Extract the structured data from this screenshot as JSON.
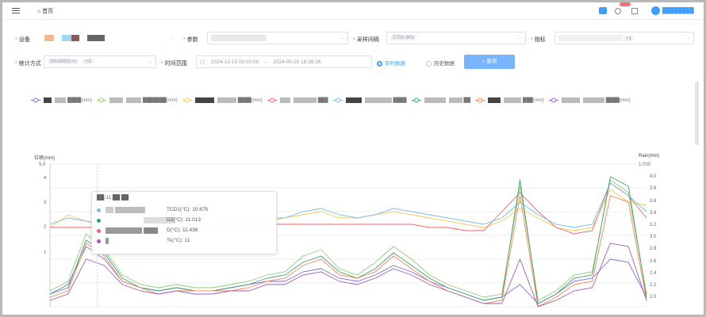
{
  "header": {
    "home_label": "首页",
    "user_name": "████████"
  },
  "filters": {
    "row1": [
      {
        "label": "设备",
        "value": ""
      },
      {
        "label": "参数",
        "value": "██"
      },
      {
        "label": "采样间隔",
        "value": "2700-90s"
      },
      {
        "label": "指标",
        "value": "+1"
      }
    ],
    "row2": {
      "label_a": "统计方式",
      "select_value": "30s/900s+x",
      "select_tag": "+3",
      "time_label": "时间范围",
      "start": "2024-12-15 00:00:00",
      "end": "2024-05-20 18:38:26",
      "radio_on": "实时数据",
      "radio_off": "历史数据",
      "query_button": "查询"
    }
  },
  "legend": [
    {
      "name": "████(mm)",
      "color": "#7b6fd8"
    },
    {
      "name": "███████(mm)",
      "color": "#91cc75"
    },
    {
      "name": "████(mm)",
      "color": "#fac858"
    },
    {
      "name": "███",
      "color": "#ee6666"
    },
    {
      "name": "████",
      "color": "#73c0de"
    },
    {
      "name": "██",
      "color": "#3ba272"
    },
    {
      "name": "███(mm)",
      "color": "#fc8452"
    },
    {
      "name": "████(mm)",
      "color": "#9a60b4"
    }
  ],
  "chart_data": {
    "type": "line",
    "ylabel_left": "位移(mm)",
    "ylabel_right": "Rain(mm)",
    "y_left_ticks": [
      "5.0",
      "4",
      "3",
      "2",
      "1"
    ],
    "y_right_ticks": [
      "1.000",
      "4.0",
      "3.8",
      "3.6",
      "3.4",
      "3.2",
      "3.0",
      "2.8",
      "2.6",
      "2.4",
      "2.2",
      "2.0"
    ],
    "series": [
      {
        "color": "#7b6fd8",
        "values": [
          0.9,
          1.2,
          2.4,
          2.0,
          1.3,
          1.1,
          1.0,
          1.1,
          1.0,
          1.0,
          1.1,
          1.2,
          1.3,
          1.3,
          1.6,
          1.7,
          1.4,
          1.3,
          1.5,
          1.8,
          1.6,
          1.3,
          1.1,
          0.9,
          0.7,
          0.8,
          1.2,
          0.6,
          0.9,
          1.3,
          1.4,
          2.0,
          1.9,
          0.8
        ]
      },
      {
        "color": "#91cc75",
        "values": [
          1.0,
          1.3,
          2.8,
          2.3,
          1.5,
          1.2,
          1.1,
          1.2,
          1.1,
          1.1,
          1.2,
          1.3,
          1.5,
          1.6,
          2.1,
          2.3,
          1.7,
          1.5,
          1.9,
          2.4,
          2.0,
          1.5,
          1.2,
          1.0,
          0.8,
          0.9,
          4.3,
          0.7,
          1.0,
          1.5,
          1.6,
          4.5,
          4.1,
          0.9
        ]
      },
      {
        "color": "#fac858",
        "values": [
          3.0,
          3.4,
          3.2,
          3.0,
          3.0,
          2.9,
          3.0,
          3.0,
          3.1,
          3.1,
          3.1,
          3.2,
          3.2,
          3.3,
          3.4,
          3.5,
          3.3,
          3.3,
          3.4,
          3.5,
          3.4,
          3.3,
          3.2,
          3.1,
          3.0,
          3.2,
          3.6,
          3.3,
          3.0,
          2.9,
          3.0,
          4.2,
          3.8,
          3.7
        ]
      },
      {
        "color": "#ee6666",
        "values": [
          3.0,
          3.0,
          3.0,
          3.0,
          3.0,
          3.0,
          3.0,
          3.0,
          3.0,
          3.0,
          3.0,
          3.0,
          3.1,
          3.1,
          3.1,
          3.1,
          3.1,
          3.1,
          3.1,
          3.1,
          3.1,
          3.0,
          3.0,
          2.9,
          2.9,
          3.5,
          4.1,
          3.5,
          3.0,
          2.8,
          2.9,
          4.4,
          4.0,
          3.3
        ]
      },
      {
        "color": "#73c0de",
        "values": [
          3.1,
          3.3,
          3.2,
          3.1,
          3.0,
          3.0,
          3.0,
          3.1,
          3.1,
          3.1,
          3.2,
          3.2,
          3.3,
          3.3,
          3.5,
          3.6,
          3.4,
          3.3,
          3.4,
          3.6,
          3.5,
          3.4,
          3.3,
          3.2,
          3.1,
          3.3,
          3.8,
          3.4,
          3.1,
          3.0,
          3.1,
          4.4,
          4.0,
          3.5
        ]
      },
      {
        "color": "#3ba272",
        "values": [
          0.9,
          1.1,
          2.6,
          2.2,
          1.4,
          1.1,
          1.0,
          1.1,
          1.0,
          1.0,
          1.1,
          1.2,
          1.4,
          1.5,
          1.9,
          2.1,
          1.6,
          1.4,
          1.7,
          2.2,
          1.8,
          1.4,
          1.1,
          0.9,
          0.7,
          0.8,
          4.5,
          0.6,
          0.9,
          1.4,
          1.5,
          4.6,
          4.3,
          0.8
        ]
      },
      {
        "color": "#fc8452",
        "values": [
          0.8,
          1.0,
          2.5,
          2.1,
          1.3,
          1.1,
          0.9,
          1.0,
          1.0,
          1.0,
          1.0,
          1.1,
          1.3,
          1.4,
          1.8,
          2.0,
          1.5,
          1.4,
          1.6,
          2.1,
          1.7,
          1.3,
          1.0,
          0.8,
          0.6,
          0.7,
          4.0,
          0.5,
          0.8,
          1.2,
          1.3,
          4.0,
          3.8,
          0.7
        ]
      },
      {
        "color": "#9a60b4",
        "values": [
          0.7,
          0.9,
          2.0,
          1.8,
          1.2,
          1.0,
          0.9,
          1.0,
          0.9,
          0.9,
          1.0,
          1.0,
          1.2,
          1.2,
          1.5,
          1.6,
          1.3,
          1.2,
          1.4,
          1.7,
          1.5,
          1.2,
          1.0,
          0.8,
          0.6,
          0.6,
          2.0,
          0.5,
          0.7,
          1.0,
          1.1,
          2.5,
          2.4,
          0.7
        ]
      }
    ]
  },
  "tooltip": {
    "title": "██-11 ██:██",
    "rows": [
      {
        "color": "#73c0de",
        "label": "TCD1(°C):",
        "value": "10.675"
      },
      {
        "color": "#3ba272",
        "label": "D2(°C):",
        "value": "11.013"
      },
      {
        "color": "#ee6666",
        "label": "D(°C):",
        "value": "11.438"
      },
      {
        "color": "#9a60b4",
        "label": "Tk(°C):",
        "value": "11"
      }
    ]
  }
}
